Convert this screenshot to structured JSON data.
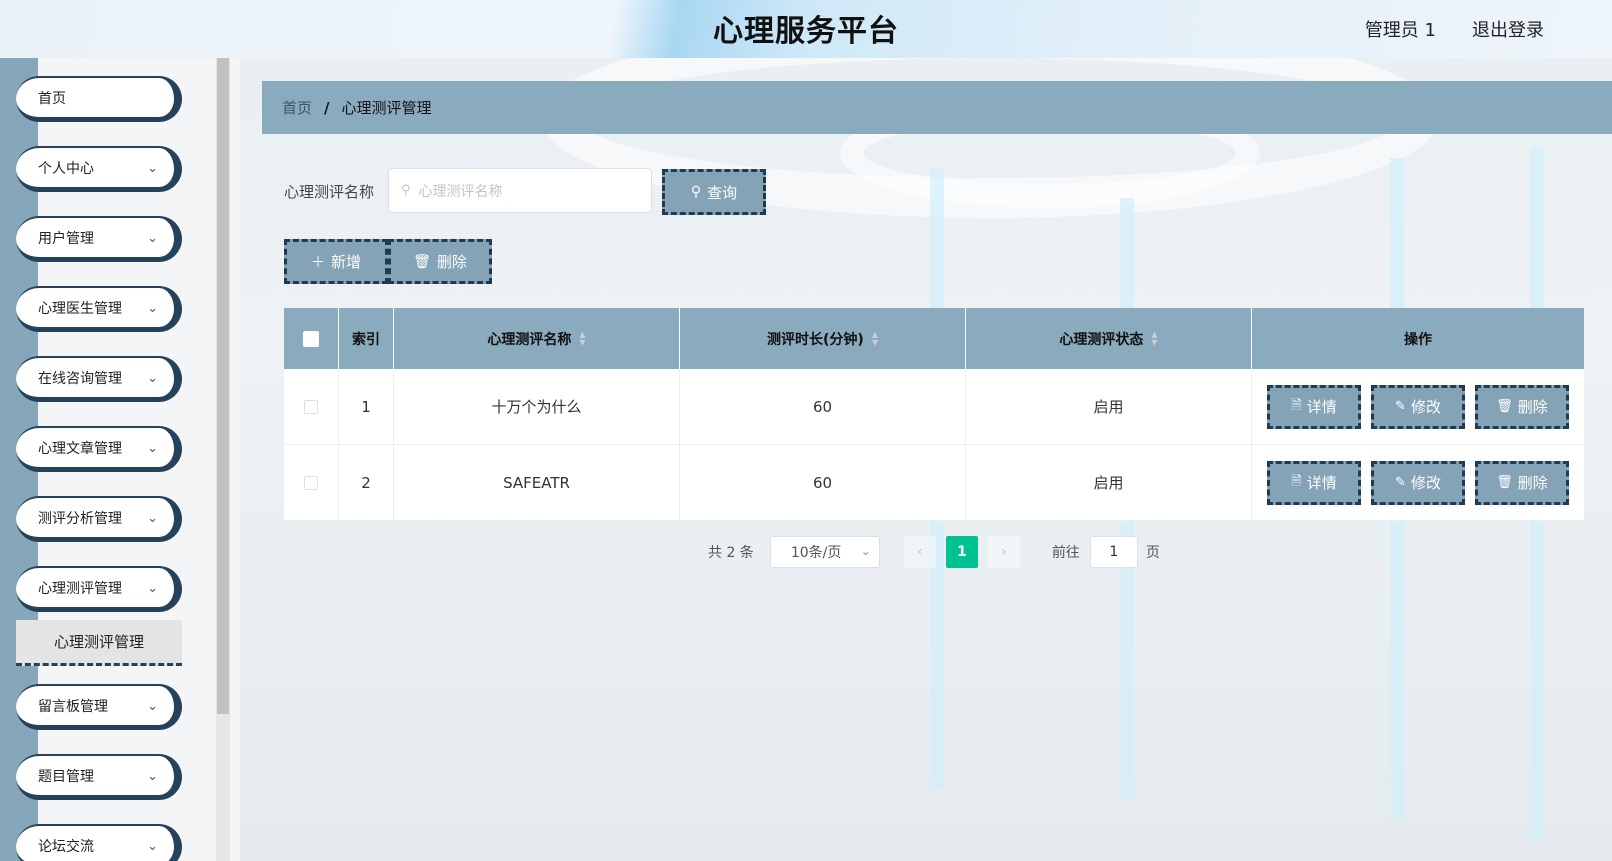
{
  "header": {
    "title": "心理服务平台",
    "user": "管理员 1",
    "logout": "退出登录"
  },
  "sidebar": {
    "items": [
      {
        "label": "首页",
        "has_children": false
      },
      {
        "label": "个人中心",
        "has_children": true
      },
      {
        "label": "用户管理",
        "has_children": true
      },
      {
        "label": "心理医生管理",
        "has_children": true
      },
      {
        "label": "在线咨询管理",
        "has_children": true
      },
      {
        "label": "心理文章管理",
        "has_children": true
      },
      {
        "label": "测评分析管理",
        "has_children": true
      },
      {
        "label": "心理测评管理",
        "has_children": true
      },
      {
        "label": "留言板管理",
        "has_children": true
      },
      {
        "label": "题目管理",
        "has_children": true
      },
      {
        "label": "论坛交流",
        "has_children": true
      }
    ],
    "submenu": {
      "label": "心理测评管理"
    }
  },
  "breadcrumb": {
    "home": "首页",
    "separator": "/",
    "current": "心理测评管理"
  },
  "search": {
    "label": "心理测评名称",
    "placeholder": "心理测评名称",
    "button": "查询"
  },
  "toolbar": {
    "add": "新增",
    "delete": "删除"
  },
  "table": {
    "columns": [
      "索引",
      "心理测评名称",
      "测评时长(分钟)",
      "心理测评状态",
      "操作"
    ],
    "rows": [
      {
        "index": "1",
        "name": "十万个为什么",
        "duration": "60",
        "status": "启用"
      },
      {
        "index": "2",
        "name": "SAFEATR",
        "duration": "60",
        "status": "启用"
      }
    ],
    "actions": {
      "detail": "详情",
      "edit": "修改",
      "delete": "删除"
    }
  },
  "pagination": {
    "total": "共 2 条",
    "page_size": "10条/页",
    "current_page": "1",
    "goto_label": "前往",
    "goto_value": "1",
    "page_unit": "页"
  },
  "colors": {
    "accent": "#8aaabe",
    "button": "#84a3b7",
    "dark": "#26425a",
    "page_active": "#00c292"
  }
}
